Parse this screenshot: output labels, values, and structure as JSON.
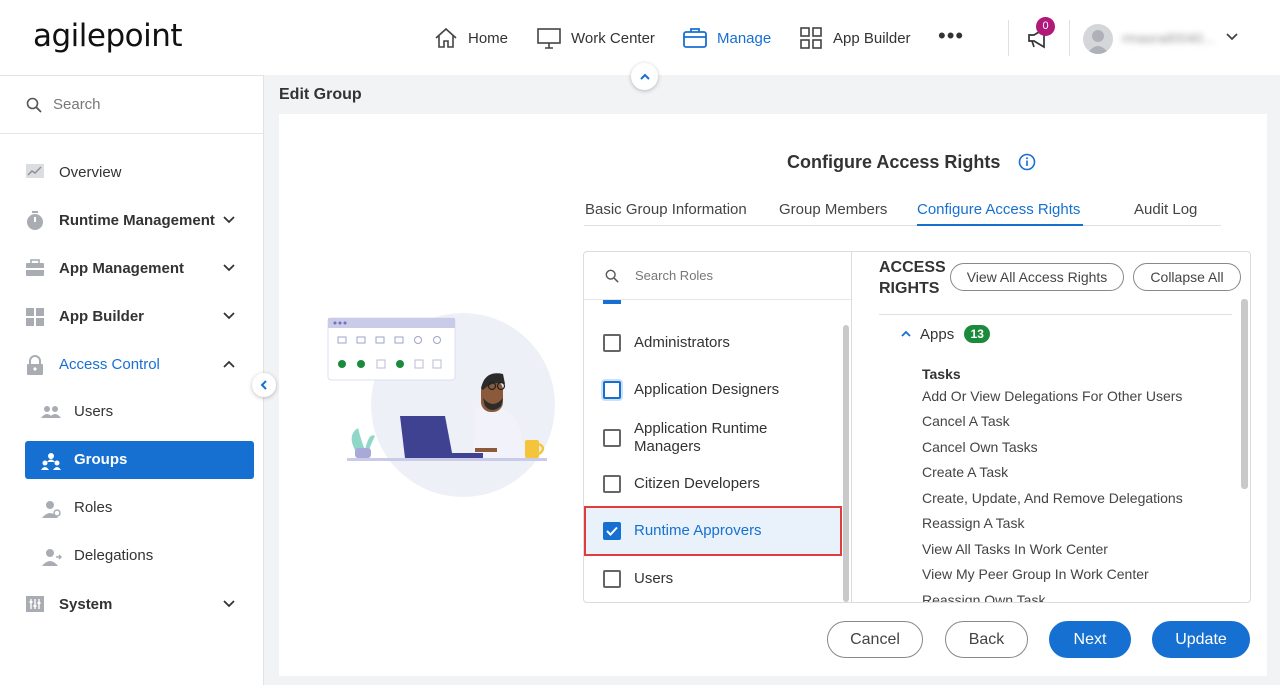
{
  "app": {
    "logo": "agilepoint"
  },
  "topnav": {
    "items": [
      {
        "label": "Home",
        "icon": "home-icon"
      },
      {
        "label": "Work Center",
        "icon": "monitor-icon"
      },
      {
        "label": "Manage",
        "icon": "briefcase-icon",
        "active": true
      },
      {
        "label": "App Builder",
        "icon": "grid-icon"
      }
    ],
    "more": "•••",
    "notifications_count": "0",
    "user_name": "rmasrail0040..."
  },
  "sidebar": {
    "search_placeholder": "Search",
    "items": [
      {
        "label": "Overview",
        "icon": "chart-icon"
      },
      {
        "label": "Runtime Management",
        "icon": "timer-icon",
        "expandable": true
      },
      {
        "label": "App Management",
        "icon": "toolbox-icon",
        "expandable": true
      },
      {
        "label": "App Builder",
        "icon": "grid-icon",
        "expandable": true
      },
      {
        "label": "Access Control",
        "icon": "lock-icon",
        "expanded": true
      },
      {
        "label": "System",
        "icon": "sliders-icon",
        "expandable": true
      }
    ],
    "access_control_children": [
      {
        "label": "Users",
        "icon": "users-icon"
      },
      {
        "label": "Groups",
        "icon": "groups-icon",
        "active": true
      },
      {
        "label": "Roles",
        "icon": "user-role-icon"
      },
      {
        "label": "Delegations",
        "icon": "delegation-icon"
      }
    ]
  },
  "page": {
    "title": "Edit Group",
    "card_title": "Configure Access Rights",
    "tabs": [
      {
        "label": "Basic Group Information"
      },
      {
        "label": "Group Members"
      },
      {
        "label": "Configure Access Rights",
        "active": true
      },
      {
        "label": "Audit Log"
      }
    ]
  },
  "roles": {
    "search_placeholder": "Search Roles",
    "items": [
      {
        "label": "Administrators",
        "checked": false
      },
      {
        "label": "Application Designers",
        "checked": false,
        "focused": true
      },
      {
        "label": "Application Runtime Managers",
        "checked": false
      },
      {
        "label": "Citizen Developers",
        "checked": false
      },
      {
        "label": "Runtime Approvers",
        "checked": true,
        "selected": true
      },
      {
        "label": "Users",
        "checked": false
      }
    ]
  },
  "rights": {
    "title_line1": "ACCESS",
    "title_line2": "RIGHTS",
    "view_all_label": "View All Access Rights",
    "collapse_all_label": "Collapse All",
    "group_label": "Apps",
    "group_count": "13",
    "section_heading": "Tasks",
    "items": [
      "Add Or View Delegations For Other Users",
      "Cancel A Task",
      "Cancel Own Tasks",
      "Create A Task",
      "Create, Update, And Remove Delegations",
      "Reassign A Task",
      "View All Tasks In Work Center",
      "View My Peer Group In Work Center",
      "Reassign Own Task"
    ]
  },
  "actions": {
    "cancel": "Cancel",
    "back": "Back",
    "next": "Next",
    "update": "Update"
  },
  "colors": {
    "accent": "#1670d2",
    "badge": "#b0197a",
    "count_badge": "#1c8a3c",
    "selection_outline": "#e03c3c"
  }
}
